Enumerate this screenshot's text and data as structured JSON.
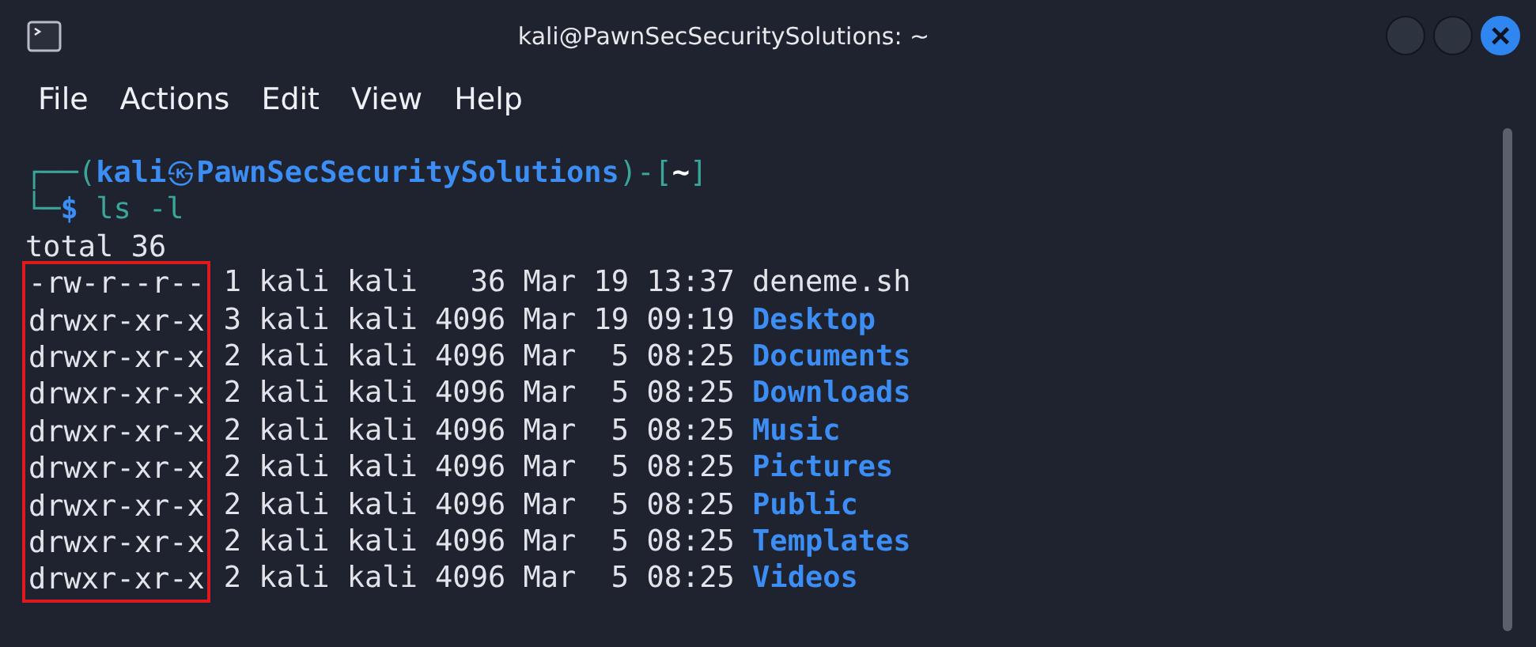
{
  "window": {
    "title": "kali@PawnSecSecuritySolutions: ~",
    "close": "×"
  },
  "menu": [
    "File",
    "Actions",
    "Edit",
    "View",
    "Help"
  ],
  "prompt": {
    "corner_top": "┌──(",
    "user": "kali",
    "at": "㉿",
    "host": "PawnSecSecuritySolutions",
    "mid": ")-[",
    "cwd": "~",
    "end": "]",
    "corner_bottom": "└─",
    "symbol": "$",
    "command": "ls -l"
  },
  "total": "total 36",
  "rows": [
    {
      "permissions": "-rw-r--r--",
      "details": "1 kali kali   36 Mar 19 13:37",
      "name": "deneme.sh",
      "kind": "file"
    },
    {
      "permissions": "drwxr-xr-x",
      "details": "3 kali kali 4096 Mar 19 09:19",
      "name": "Desktop",
      "kind": "dir"
    },
    {
      "permissions": "drwxr-xr-x",
      "details": "2 kali kali 4096 Mar  5 08:25",
      "name": "Documents",
      "kind": "dir"
    },
    {
      "permissions": "drwxr-xr-x",
      "details": "2 kali kali 4096 Mar  5 08:25",
      "name": "Downloads",
      "kind": "dir"
    },
    {
      "permissions": "drwxr-xr-x",
      "details": "2 kali kali 4096 Mar  5 08:25",
      "name": "Music",
      "kind": "dir"
    },
    {
      "permissions": "drwxr-xr-x",
      "details": "2 kali kali 4096 Mar  5 08:25",
      "name": "Pictures",
      "kind": "dir"
    },
    {
      "permissions": "drwxr-xr-x",
      "details": "2 kali kali 4096 Mar  5 08:25",
      "name": "Public",
      "kind": "dir"
    },
    {
      "permissions": "drwxr-xr-x",
      "details": "2 kali kali 4096 Mar  5 08:25",
      "name": "Templates",
      "kind": "dir"
    },
    {
      "permissions": "drwxr-xr-x",
      "details": "2 kali kali 4096 Mar  5 08:25",
      "name": "Videos",
      "kind": "dir"
    }
  ]
}
